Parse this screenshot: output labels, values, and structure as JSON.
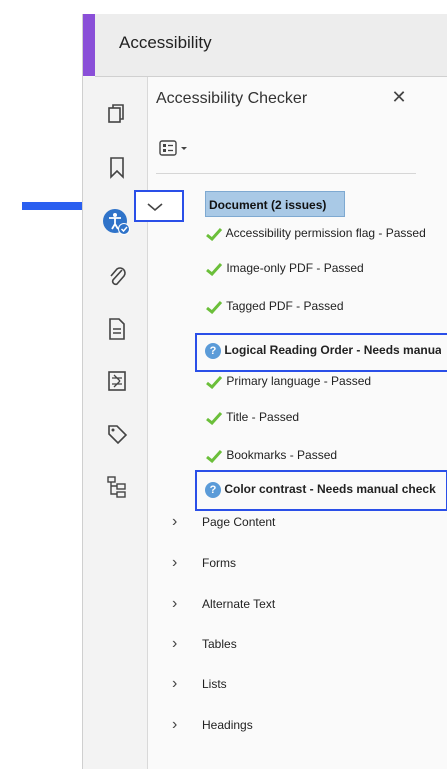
{
  "header": {
    "title": "Accessibility"
  },
  "panel": {
    "title": "Accessibility Checker",
    "document": {
      "label": "Document (2 issues)"
    },
    "document_items": [
      {
        "text": "Accessibility permission flag - Passed",
        "status": "passed"
      },
      {
        "text": "Image-only PDF - Passed",
        "status": "passed"
      },
      {
        "text": "Tagged PDF - Passed",
        "status": "passed"
      },
      {
        "text": "Logical Reading Order - Needs manual check",
        "status": "needs-check"
      },
      {
        "text": "Primary language - Passed",
        "status": "passed"
      },
      {
        "text": "Title - Passed",
        "status": "passed"
      },
      {
        "text": "Bookmarks - Passed",
        "status": "passed"
      },
      {
        "text": "Color contrast - Needs manual check",
        "status": "needs-check"
      }
    ],
    "categories": [
      "Page Content",
      "Forms",
      "Alternate Text",
      "Tables",
      "Lists",
      "Headings"
    ]
  },
  "colors": {
    "accent_purple": "#8a4fd8",
    "annotation_blue": "#2a4fe8",
    "check_green": "#6bbf3a",
    "question_blue": "#5b9bd8",
    "document_highlight": "#a9c9e6"
  },
  "rail_icons": [
    "pages-icon",
    "bookmark-icon",
    "accessibility-icon",
    "attachment-icon",
    "document-properties-icon",
    "layers-icon",
    "tags-icon",
    "content-tree-icon"
  ]
}
